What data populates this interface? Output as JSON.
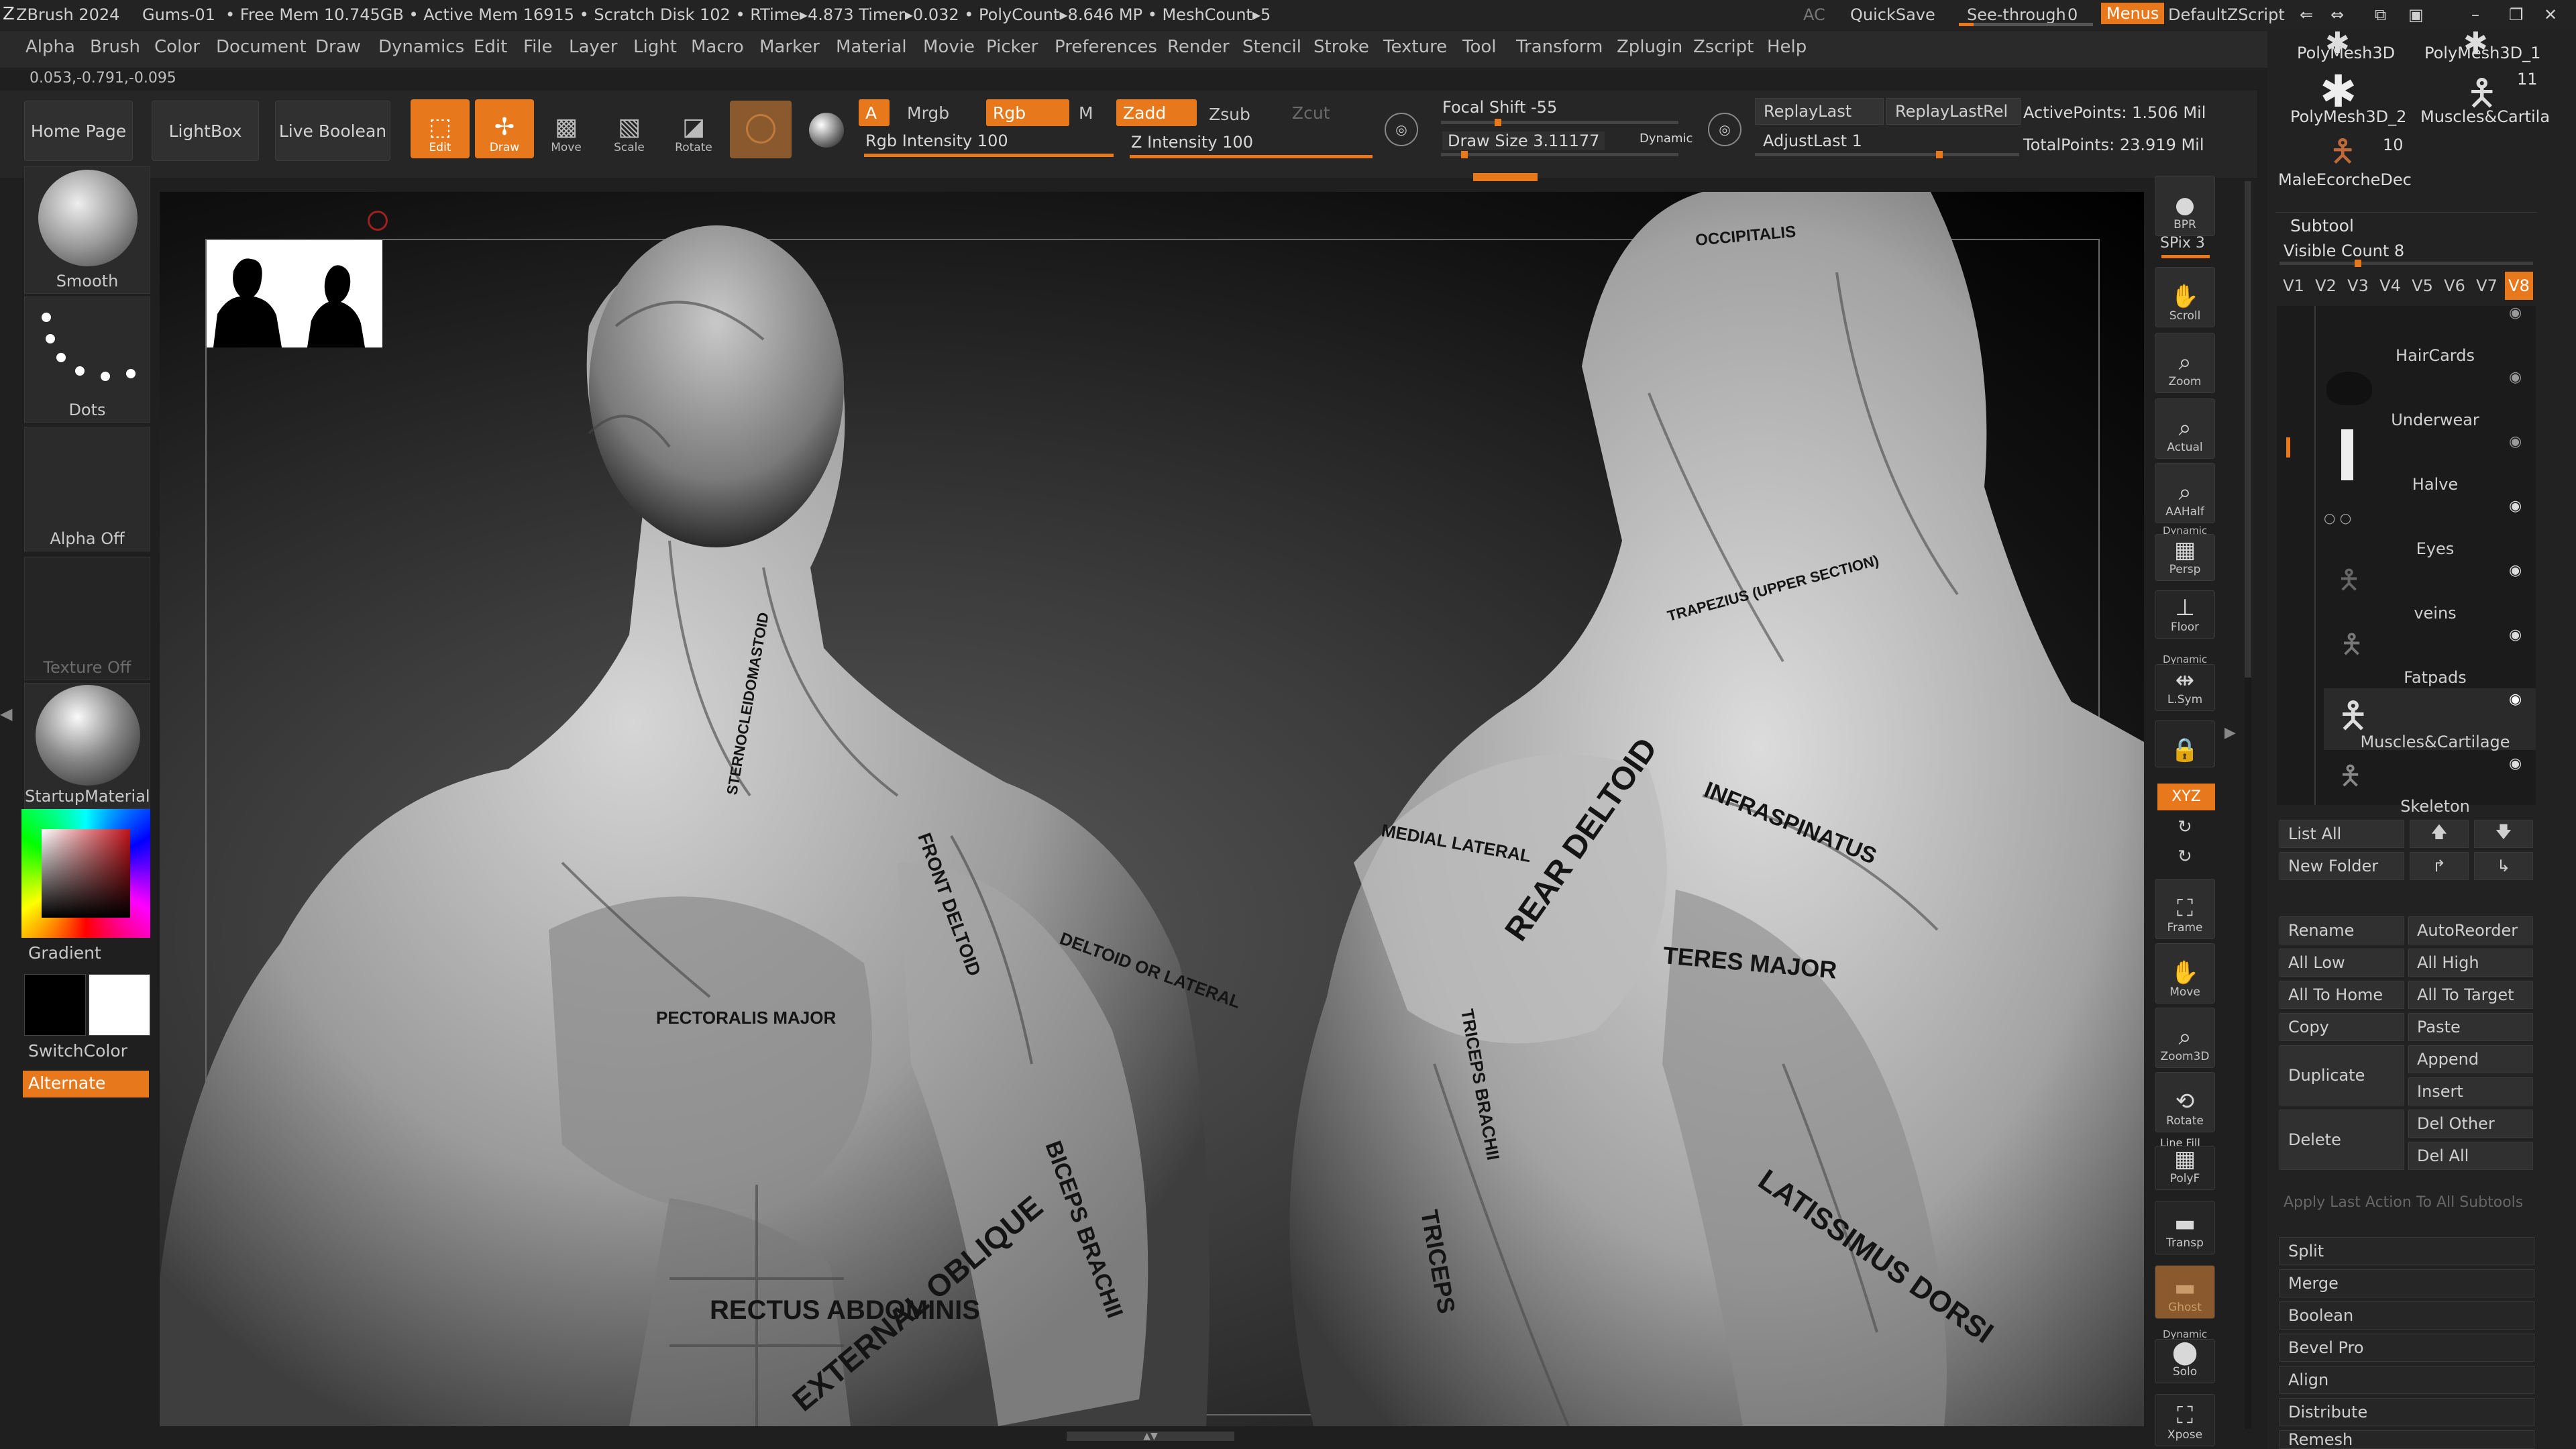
{
  "titlebar": {
    "app": "ZBrush 2024",
    "doc": "Gums-01",
    "stats": "• Free Mem 10.745GB • Active Mem 16915 • Scratch Disk 102 • RTime▸4.873 Timer▸0.032 • PolyCount▸8.646 MP • MeshCount▸5",
    "ac": "AC",
    "quicksave": "QuickSave",
    "seethrough": "See-through",
    "seethrough_val": "0",
    "menus": "Menus",
    "script": "DefaultZScript"
  },
  "menu": [
    "Alpha",
    "Brush",
    "Color",
    "Document",
    "Draw",
    "Dynamics",
    "Edit",
    "File",
    "Layer",
    "Light",
    "Macro",
    "Marker",
    "Material",
    "Movie",
    "Picker",
    "Preferences",
    "Render",
    "Stencil",
    "Stroke",
    "Texture",
    "Tool",
    "Transform",
    "Zplugin",
    "Zscript",
    "Help"
  ],
  "coords": "0.053,-0.791,-0.095",
  "nav": {
    "home": "Home Page",
    "lightbox": "LightBox",
    "live_boolean": "Live Boolean"
  },
  "tools": {
    "edit": "Edit",
    "draw": "Draw",
    "move": "Move",
    "scale": "Scale",
    "rotate": "Rotate"
  },
  "chips": {
    "a": "A",
    "mrgb": "Mrgb",
    "rgb": "Rgb",
    "m": "M",
    "zadd": "Zadd",
    "zsub": "Zsub",
    "zcut": "Zcut"
  },
  "sliders": {
    "rgb_intensity": "Rgb Intensity 100",
    "z_intensity": "Z Intensity 100",
    "focal_shift": "Focal Shift -55",
    "draw_size": "Draw Size 3.11177",
    "dynamic": "Dynamic"
  },
  "replay": {
    "last": "ReplayLast",
    "lastrel": "ReplayLastRel",
    "adjust": "AdjustLast 1"
  },
  "points": {
    "active": "ActivePoints: 1.506 Mil",
    "total": "TotalPoints: 23.919 Mil"
  },
  "leftshelf": {
    "smooth": "Smooth",
    "dots": "Dots",
    "alpha": "Alpha Off",
    "texture": "Texture Off",
    "material": "StartupMaterial",
    "gradient": "Gradient",
    "switchcolor": "SwitchColor",
    "alternate": "Alternate"
  },
  "rightshelf": [
    "BPR",
    "SPix 3",
    "Scroll",
    "Zoom",
    "Actual",
    "AAHalf",
    "Persp",
    "Floor",
    "L.Sym",
    "XYZ",
    "Frame",
    "Move",
    "Zoom3D",
    "Rotate",
    "PolyF",
    "Transp",
    "Ghost",
    "Solo",
    "Xpose"
  ],
  "rightshelf_extra": {
    "dynamic": "Dynamic",
    "line_fill": "Line Fill"
  },
  "tray_top": {
    "m1": "PolyMesh3D",
    "m2": "PolyMesh3D_1",
    "m3": "PolyMesh3D_2",
    "m4": "Muscles&Cartila",
    "m5": "MaleEcorcheDec",
    "c1": "11",
    "c2": "10"
  },
  "subtool": {
    "title": "Subtool",
    "visible": "Visible Count 8",
    "tabs": [
      "V1",
      "V2",
      "V3",
      "V4",
      "V5",
      "V6",
      "V7",
      "V8"
    ],
    "items": [
      "HairCards",
      "Underwear",
      "Halve",
      "Eyes",
      "veins",
      "Fatpads",
      "Muscles&Cartilage",
      "Skeleton"
    ]
  },
  "subtool_btns": {
    "listall": "List All",
    "newfolder": "New Folder",
    "rename": "Rename",
    "autoreorder": "AutoReorder",
    "alllow": "All Low",
    "allhigh": "All High",
    "alltohome": "All To Home",
    "alltotarget": "All To Target",
    "copy": "Copy",
    "paste": "Paste",
    "duplicate": "Duplicate",
    "append": "Append",
    "insert": "Insert",
    "delete": "Delete",
    "delother": "Del Other",
    "delall": "Del All",
    "applylast": "Apply Last Action To All Subtools"
  },
  "tray_menus": [
    "Split",
    "Merge",
    "Boolean",
    "Bevel Pro",
    "Align",
    "Distribute",
    "Remesh"
  ],
  "labels": {
    "front": [
      "RECTUS ABDOMINIS",
      "EXTERNAL OBLIQUE",
      "PECTORALIS MAJOR",
      "FRONT DELTOID",
      "BICEPS BRACHII",
      "DELTOID OR LATERAL",
      "STERNOCLEIDOMASTOID"
    ],
    "back": [
      "REAR DELTOID",
      "INFRASPINATUS",
      "TERES MAJOR",
      "LATISSIMUS DORSI",
      "TRICEPS BRACHII",
      "TRICEPS",
      "MEDIAL LATERAL",
      "OCCIPITALIS",
      "TRAPEZIUS (UPPER SECTION)"
    ]
  },
  "colors": {
    "accent": "#e8781c"
  }
}
